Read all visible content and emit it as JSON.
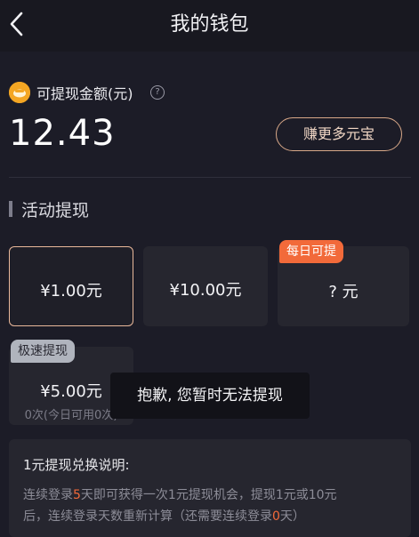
{
  "header": {
    "title": "我的钱包",
    "back_icon": "chevron-left-icon"
  },
  "balance": {
    "label": "可提现金额(元)",
    "help_glyph": "?",
    "amount": "12.43",
    "earn_button": "赚更多元宝",
    "coin_icon": "coin-icon"
  },
  "section": {
    "title": "活动提现"
  },
  "options": [
    {
      "price": "¥1.00元",
      "selected": true
    },
    {
      "price": "¥10.00元"
    },
    {
      "price": "? 元",
      "tag": "每日可提"
    },
    {
      "price": "¥5.00元",
      "tag": "极速提现",
      "note": "0次(今日可用0次)"
    }
  ],
  "toast": {
    "text": "抱歉, 您暂时无法提现"
  },
  "info": {
    "title": "1元提现兑换说明:",
    "line1_pre": "连续登录",
    "line1_num": "5",
    "line1_post": "天即可获得一次1元提现机会，提现1元或10元",
    "line2_pre": "后，连续登录天数重新计算（还需要连续登录",
    "line2_num": "0",
    "line2_post": "天）"
  },
  "colors": {
    "background": "#1c1c27",
    "card": "#26262f",
    "accent_orange": "#f26a3a",
    "selected_border": "#e9b89a",
    "coin": "#f4a623"
  }
}
